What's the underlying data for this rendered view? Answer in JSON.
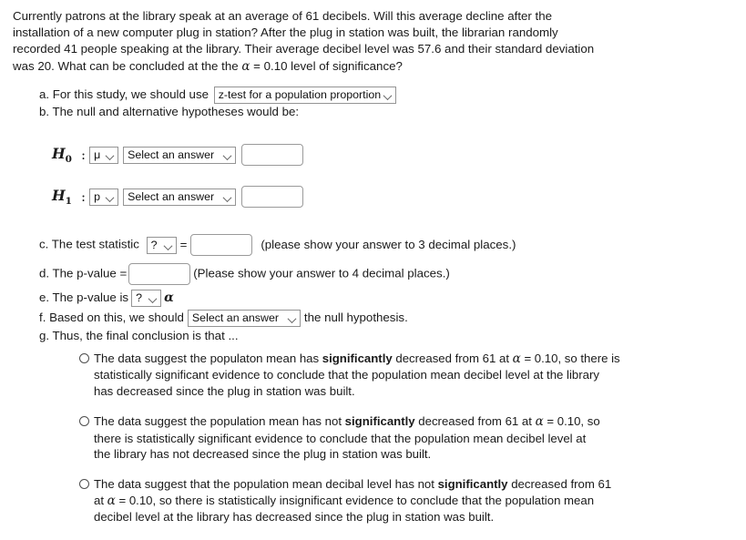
{
  "problem": {
    "lines": [
      "Currently patrons at the library speak at an average of 61 decibels. Will this average decline after the",
      "installation of a new computer plug in station? After the plug in station was built, the librarian randomly",
      "recorded 41 people speaking at the library. Their average decibel level was 57.6 and their standard deviation",
      "was 20. What can be concluded at the the "
    ],
    "alpha_symbol": "α",
    "alpha_tail": " = 0.10 level of significance?"
  },
  "part_a": {
    "label": "a. For this study, we should use",
    "test_select_value": "z-test for a population proportion"
  },
  "part_b": {
    "label": "b. The null and alternative hypotheses would be:"
  },
  "hypotheses": [
    {
      "name": "H",
      "sub": "0",
      "colon": ":",
      "param_value": "μ",
      "comparison_value": "Select an answer",
      "number_value": ""
    },
    {
      "name": "H",
      "sub": "1",
      "colon": ":",
      "param_value": "p",
      "comparison_value": "Select an answer",
      "number_value": ""
    }
  ],
  "part_c": {
    "label": "c. The test statistic",
    "stat_select_value": "?",
    "equals": "=",
    "value": "",
    "hint": "(please show your answer to 3 decimal places.)"
  },
  "part_d": {
    "label": "d. The p-value =",
    "value": "",
    "hint": "(Please show your answer to 4 decimal places.)"
  },
  "part_e": {
    "label": "e. The p-value is",
    "compare_select_value": "?",
    "alpha_symbol": "α"
  },
  "part_f": {
    "label_before": "f. Based on this, we should",
    "decision_select_value": "Select an answer",
    "label_after": "the null hypothesis."
  },
  "part_g": {
    "label": "g. Thus, the final conclusion is that ..."
  },
  "choices": [
    {
      "lines": [
        [
          "The data suggest the populaton mean has ",
          "significantly",
          " decreased from 61 at ",
          "α",
          " = 0.10, so there is"
        ],
        [
          "statistically significant evidence to conclude that the population mean decibel level at the library"
        ],
        [
          "has decreased since the plug in station was built."
        ]
      ]
    },
    {
      "lines": [
        [
          "The data suggest the population mean has not ",
          "significantly",
          " decreased from 61 at ",
          "α",
          " = 0.10, so"
        ],
        [
          "there is statistically significant evidence to conclude that the population mean decibel level at"
        ],
        [
          "the library has not decreased since the plug in station was built."
        ]
      ]
    },
    {
      "lines": [
        [
          "The data suggest that the population mean decibal level has not ",
          "significantly",
          " decreased from 61"
        ],
        [
          "at ",
          "α",
          " = 0.10, so there is statistically insignificant evidence to conclude that the population mean"
        ],
        [
          "decibel level at the library has decreased since the plug in station was built."
        ]
      ]
    }
  ]
}
